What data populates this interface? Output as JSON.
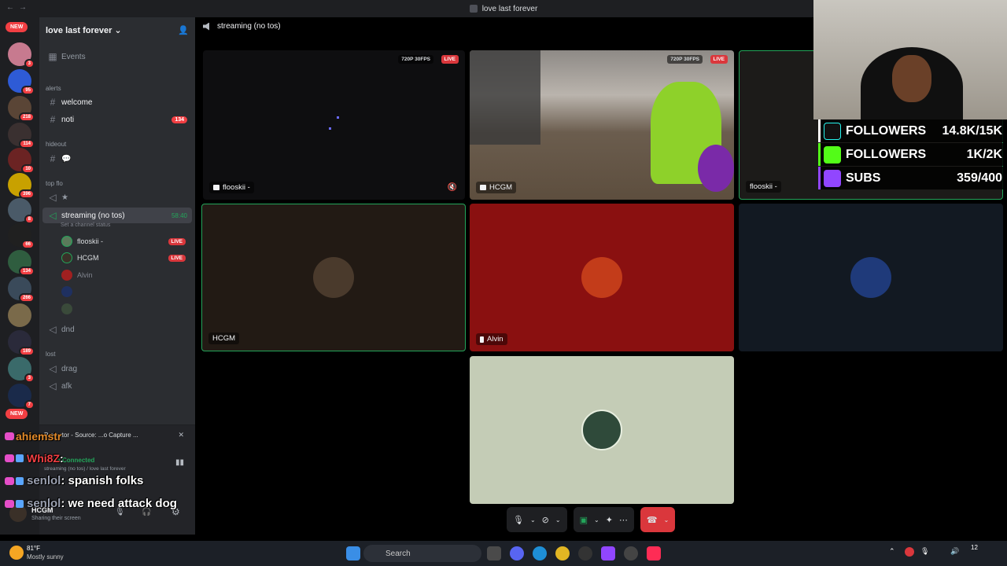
{
  "window": {
    "title": "love last forever"
  },
  "rail": {
    "new_top": "NEW",
    "new_bottom": "NEW",
    "badges": [
      "3",
      "95",
      "218",
      "114",
      "10",
      "396",
      "8",
      "66",
      "134",
      "266",
      "189",
      "3",
      "7"
    ]
  },
  "sidebar": {
    "server_name": "love last forever",
    "events_label": "Events",
    "cat_alerts": "alerts",
    "ch_welcome": "welcome",
    "ch_noti": "noti",
    "noti_count": "134",
    "cat_hideout": "hideout",
    "ch_hideout_emoji": "💬",
    "cat_topflo": "top flo",
    "ch_star": "★",
    "ch_streaming": "streaming (no tos)",
    "streaming_timer": "58:40",
    "streaming_status": "Set a channel status",
    "users": [
      {
        "name": "flooskii -",
        "live": "LIVE"
      },
      {
        "name": "HCGM",
        "live": "LIVE"
      },
      {
        "name": "Alvin"
      }
    ],
    "ch_dnd": "dnd",
    "cat_lost": "lost",
    "ch_drag": "drag",
    "ch_afk": "afk"
  },
  "panel": {
    "projector_label": "Projector - Source: ...o Capture ...",
    "voice_connected": "Voice Connected",
    "voice_path": "streaming (no tos) / love last forever",
    "username": "HCGM",
    "user_status": "Sharing their screen"
  },
  "chat": [
    {
      "user": "ahiemstr",
      "message": ""
    },
    {
      "user": "Whi8Z",
      "message": ":"
    },
    {
      "user": "senlol",
      "message": ": spanish folks"
    },
    {
      "user": "senlol",
      "message": ": we need attack dog"
    }
  ],
  "main": {
    "channel_title": "streaming (no tos)",
    "tiles": {
      "t1_label": "flooskii -",
      "t1_res": "720P 30FPS",
      "t1_live": "LIVE",
      "t2_label": "HCGM",
      "t2_res": "720P 30FPS",
      "t2_live": "LIVE",
      "t3_label": "flooskii -",
      "t4_label": "HCGM",
      "t5_label": "Alvin"
    }
  },
  "overlay": {
    "tiktok_label": "FOLLOWERS",
    "tiktok_value": "14.8K/15K",
    "kick_label": "FOLLOWERS",
    "kick_value": "1K/2K",
    "twitch_label": "SUBS",
    "twitch_value": "359/400"
  },
  "taskbar": {
    "weather_temp": "81°F",
    "weather_desc": "Mostly sunny",
    "search_placeholder": "Search",
    "clock_partial": "12"
  },
  "colors": {
    "discord_bg": "#2b2d31",
    "live_red": "#da373c",
    "speaking_green": "#23a55a",
    "alvin_tile": "#8a1010",
    "hcgm_tile": "#221a14",
    "green_tile": "#c4ccb6"
  }
}
